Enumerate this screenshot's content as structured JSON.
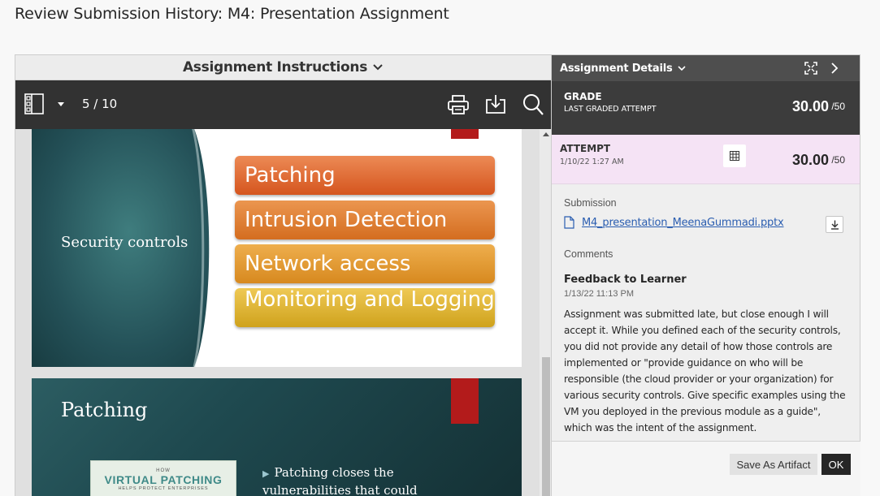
{
  "page": {
    "title": "Review Submission History: M4: Presentation Assignment"
  },
  "instructions": {
    "header_label": "Assignment Instructions",
    "toolbar": {
      "page_indicator": "5 / 10"
    },
    "slides": [
      {
        "title": "Security controls",
        "bars": [
          "Patching",
          "Intrusion Detection",
          "Network access",
          "Monitoring and Logging"
        ]
      },
      {
        "title": "Patching",
        "logo": {
          "top": "HOW",
          "main": "VIRTUAL PATCHING",
          "bottom": "HELPS PROTECT ENTERPRISES"
        },
        "bullet": "Patching closes the vulnerabilities that could"
      }
    ]
  },
  "details": {
    "header_label": "Assignment Details",
    "grade": {
      "label": "GRADE",
      "sub": "LAST GRADED ATTEMPT",
      "score": "30.00",
      "max": "/50"
    },
    "attempt": {
      "label": "ATTEMPT",
      "date": "1/10/22 1:27 AM",
      "score": "30.00",
      "max": "/50"
    },
    "submission": {
      "label": "Submission",
      "file": "M4_presentation_MeenaGummadi.pptx"
    },
    "comments": {
      "label": "Comments",
      "feedback_title": "Feedback to Learner",
      "feedback_date": "1/13/22 11:13 PM",
      "feedback_text": "Assignment was submitted late, but close enough I will accept it.  While you defined each of the security controls, you did not provide any detail of how those controls are implemented or \"provide guidance on who will be responsible (the cloud provider or your organization) for various security controls. Give specific examples using the VM you deployed in the previous module as a guide\", which was the intent of the assignment."
    },
    "buttons": {
      "save_artifact": "Save As Artifact",
      "ok": "OK"
    }
  },
  "colors": {
    "toolbar_bg": "#323232",
    "grade_bg": "#3c3c3c",
    "attempt_bg": "#f5e3f5",
    "link": "#2a5db0",
    "ribbon": "#b31b1b"
  }
}
